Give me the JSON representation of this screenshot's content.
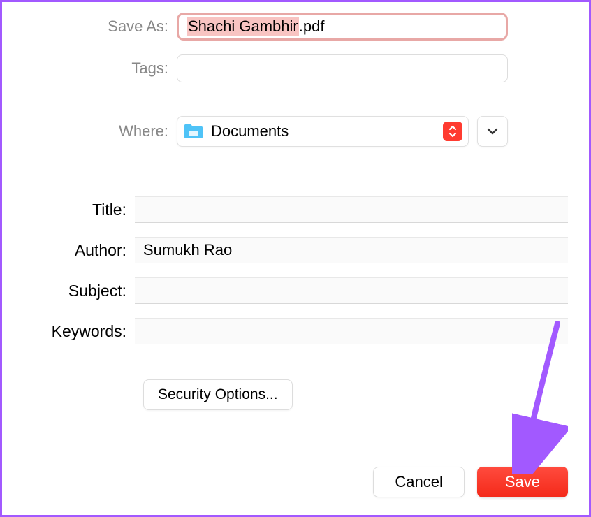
{
  "top": {
    "save_as_label": "Save As:",
    "save_as_value_selected": "Shachi Gambhir",
    "save_as_value_ext": ".pdf",
    "tags_label": "Tags:",
    "tags_value": "",
    "where_label": "Where:",
    "where_value": "Documents"
  },
  "metadata": {
    "title_label": "Title:",
    "title_value": "",
    "author_label": "Author:",
    "author_value": "Sumukh Rao",
    "subject_label": "Subject:",
    "subject_value": "",
    "keywords_label": "Keywords:",
    "keywords_value": "",
    "security_button": "Security Options..."
  },
  "footer": {
    "cancel_label": "Cancel",
    "save_label": "Save"
  }
}
